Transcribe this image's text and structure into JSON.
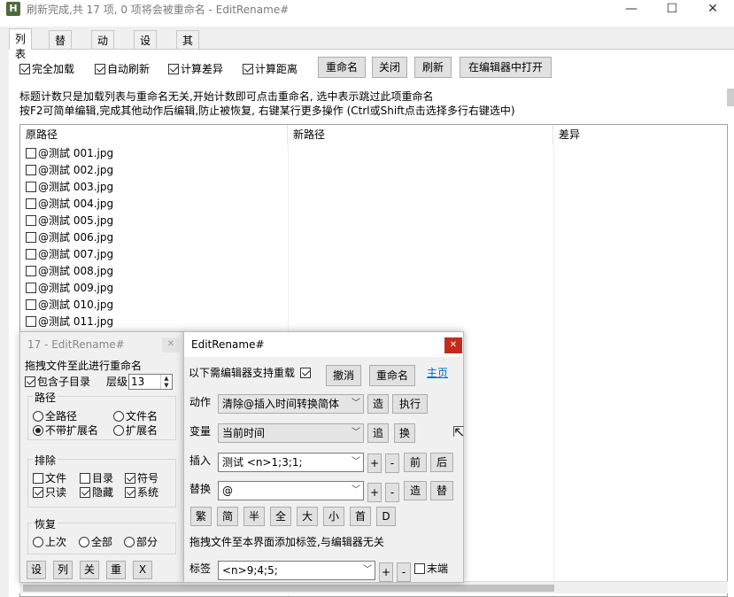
{
  "window": {
    "title": "刷新完成,共 17 项, 0 项将会被重命名 - EditRename#",
    "icon_letter": "H",
    "controls": {
      "minimize": "—",
      "maximize": "☐",
      "close": "✕"
    }
  },
  "tabs": [
    "列表",
    "替换",
    "动作",
    "设置",
    "其他"
  ],
  "options": {
    "full_load": "完全加载",
    "auto_refresh": "自动刷新",
    "count_diff": "计算差异",
    "count_distance": "计算距离"
  },
  "toolbar": {
    "rename": "重命名",
    "close": "关闭",
    "refresh": "刷新",
    "open_in_editor": "在编辑器中打开"
  },
  "hints": {
    "line1": "标题计数只是加载列表与重命名无关,开始计数即可点击重命名, 选中表示跳过此项重命名",
    "line2": "按F2可简单编辑,完成其他动作后编辑,防止被恢复, 右键某行更多操作 (Ctrl或Shift点击选择多行右键选中)"
  },
  "list": {
    "columns": [
      "原路径",
      "新路径",
      "差异"
    ],
    "rows": [
      "@测試 001.jpg",
      "@测試 002.jpg",
      "@测試 003.jpg",
      "@测試 004.jpg",
      "@测試 005.jpg",
      "@测試 006.jpg",
      "@测試 007.jpg",
      "@测試 008.jpg",
      "@测試 009.jpg",
      "@测試 010.jpg",
      "@测試 011.jpg"
    ]
  },
  "dialog1": {
    "title": "17 - EditRename#",
    "drag_hint": "拖拽文件至此进行重命名",
    "include_sub": "包含子目录",
    "level_label": "层级",
    "level_value": "13",
    "path_group": "路径",
    "path_options": [
      "全路径",
      "文件名",
      "不带扩展名",
      "扩展名"
    ],
    "exclude_group": "排除",
    "exclude_options": [
      "文件",
      "目录",
      "符号",
      "只读",
      "隐藏",
      "系统"
    ],
    "restore_group": "恢复",
    "restore_options": [
      "上次",
      "全部",
      "部分"
    ],
    "buttons": [
      "设",
      "列",
      "关",
      "重",
      "X"
    ]
  },
  "dialog2": {
    "title": "EditRename#",
    "reload_hint": "以下需编辑器支持重载",
    "undo": "撤消",
    "rename": "重命名",
    "home": "主页",
    "action_label": "动作",
    "action_value": "清除@插入时间转换简体",
    "make": "造",
    "execute": "执行",
    "var_label": "变量",
    "var_value": "当前时间",
    "chase": "追",
    "swap": "换",
    "insert_label": "插入",
    "insert_value": "测试  <n>1;3;1;",
    "plus": "+",
    "minus": "-",
    "front": "前",
    "back": "后",
    "replace_label": "替换",
    "replace_value": "@",
    "make2": "造",
    "replace_btn": "替",
    "convert_buttons": [
      "繁",
      "简",
      "半",
      "全",
      "大",
      "小",
      "首",
      "D"
    ],
    "drag_tag_hint": "拖拽文件至本界面添加标签,与编辑器无关",
    "tag_label": "标签",
    "tag_value": "<n>9;4;5;",
    "end": "末端"
  }
}
